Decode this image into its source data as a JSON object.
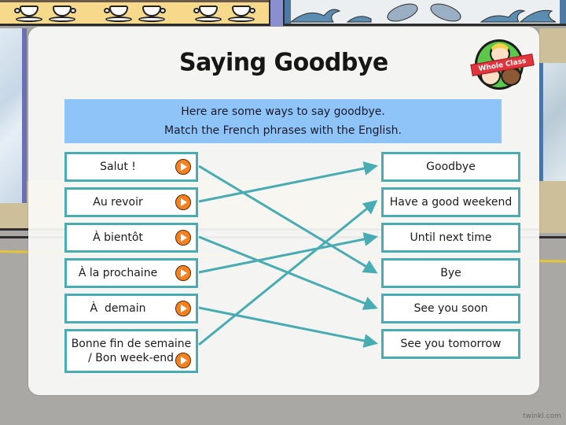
{
  "header": {
    "title": "Saying Goodbye",
    "badge_label": "Whole Class"
  },
  "instructions": {
    "line1": "Here are some ways to say goodbye.",
    "line2": "Match the French phrases with the English."
  },
  "french_phrases": [
    {
      "label": "Salut !",
      "audio_icon": "play-icon"
    },
    {
      "label": "Au revoir",
      "audio_icon": "play-icon"
    },
    {
      "label": "À bientôt",
      "audio_icon": "play-icon"
    },
    {
      "label": "À la prochaine",
      "audio_icon": "play-icon"
    },
    {
      "label": "À  demain",
      "audio_icon": "play-icon"
    },
    {
      "label_line1": "Bonne fin de semaine",
      "label_line2": "/ Bon week-end",
      "audio_icon": "play-icon"
    }
  ],
  "english_phrases": [
    {
      "label": "Goodbye"
    },
    {
      "label": "Have a good weekend"
    },
    {
      "label": "Until next time"
    },
    {
      "label": "Bye"
    },
    {
      "label": "See you soon"
    },
    {
      "label": "See you tomorrow"
    }
  ],
  "matches": [
    {
      "from": 0,
      "to": 3
    },
    {
      "from": 1,
      "to": 0
    },
    {
      "from": 2,
      "to": 4
    },
    {
      "from": 3,
      "to": 2
    },
    {
      "from": 4,
      "to": 5
    },
    {
      "from": 5,
      "to": 1
    }
  ],
  "colors": {
    "accent": "#48acb2",
    "instruction_bg": "#8ec4f7",
    "play_button": "#f5821f",
    "badge_green": "#5cc84a",
    "badge_ribbon": "#e1343c"
  },
  "watermark": "twinkl.com"
}
